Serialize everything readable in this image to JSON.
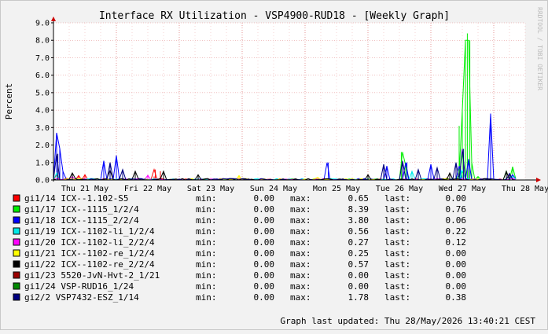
{
  "chart_data": {
    "type": "line",
    "title": "Interface RX Utilization - VSP4900-RUD18 - [Weekly Graph]",
    "ylabel": "Percent",
    "xlabel": "",
    "ylim": [
      0,
      9
    ],
    "yticks": [
      "0.0",
      "1.0",
      "2.0",
      "3.0",
      "4.0",
      "5.0",
      "6.0",
      "7.0",
      "8.0",
      "9.0"
    ],
    "xlim": [
      0,
      7.35
    ],
    "x_tick_labels": [
      {
        "x": 0.5,
        "label": "Thu 21 May"
      },
      {
        "x": 1.5,
        "label": "Fri 22 May"
      },
      {
        "x": 2.5,
        "label": "Sat 23 May"
      },
      {
        "x": 3.5,
        "label": "Sun 24 May"
      },
      {
        "x": 4.5,
        "label": "Mon 25 May"
      },
      {
        "x": 5.5,
        "label": "Tue 26 May"
      },
      {
        "x": 6.5,
        "label": "Wed 27 May"
      },
      {
        "x": 7.5,
        "label": "Thu 28 May"
      }
    ],
    "grid": true,
    "series": [
      {
        "name": "gi1/14 ICX--1.102-S5",
        "color": "#ff0000",
        "min": "0.00",
        "max": "0.65",
        "last": "0.00",
        "points": [
          [
            0.05,
            0.3
          ],
          [
            0.2,
            0.1
          ],
          [
            0.4,
            0.25
          ],
          [
            0.5,
            0.3
          ],
          [
            1.6,
            0.2
          ],
          [
            1.62,
            0.6
          ],
          [
            1.7,
            0.5
          ],
          [
            1.72,
            0.1
          ],
          [
            2.95,
            0.1
          ],
          [
            6.25,
            0.1
          ],
          [
            7.25,
            0.3
          ]
        ]
      },
      {
        "name": "gi1/17 ICX--1115_1/2/4",
        "color": "#00ee00",
        "min": "0.00",
        "max": "8.39",
        "last": "0.76",
        "points": [
          [
            5.53,
            1.6
          ],
          [
            5.6,
            0.8
          ],
          [
            6.45,
            3.1
          ],
          [
            6.46,
            0.3
          ],
          [
            6.5,
            4.0
          ],
          [
            6.55,
            8.0
          ],
          [
            6.58,
            8.39
          ],
          [
            6.62,
            8.0
          ],
          [
            6.65,
            1.0
          ],
          [
            6.75,
            0.2
          ],
          [
            7.2,
            0.5
          ],
          [
            7.3,
            0.76
          ]
        ]
      },
      {
        "name": "gi1/18 ICX--1115_2/2/4",
        "color": "#0000ff",
        "min": "0.00",
        "max": "3.80",
        "last": "0.06",
        "points": [
          [
            0.05,
            2.7
          ],
          [
            0.1,
            1.8
          ],
          [
            0.15,
            0.5
          ],
          [
            0.8,
            1.1
          ],
          [
            1.0,
            1.4
          ],
          [
            4.37,
            1.0
          ],
          [
            5.3,
            0.8
          ],
          [
            5.62,
            1.0
          ],
          [
            6.0,
            0.9
          ],
          [
            6.47,
            0.8
          ],
          [
            6.6,
            1.2
          ],
          [
            6.95,
            3.8
          ],
          [
            7.3,
            0.3
          ]
        ]
      },
      {
        "name": "gi1/19 ICX--1102-li_1/2/4",
        "color": "#00e8e8",
        "min": "0.00",
        "max": "0.56",
        "last": "0.22",
        "points": [
          [
            0.05,
            0.4
          ],
          [
            5.7,
            0.5
          ],
          [
            6.48,
            0.56
          ],
          [
            7.3,
            0.22
          ]
        ]
      },
      {
        "name": "gi1/20 ICX--1102-li_2/2/4",
        "color": "#ff00ff",
        "min": "0.00",
        "max": "0.27",
        "last": "0.12",
        "points": [
          [
            0.3,
            0.2
          ],
          [
            1.5,
            0.27
          ],
          [
            7.3,
            0.12
          ]
        ]
      },
      {
        "name": "gi1/21 ICX--1102-re_1/2/4",
        "color": "#ffff00",
        "min": "0.00",
        "max": "0.25",
        "last": "0.00",
        "points": [
          [
            2.95,
            0.25
          ],
          [
            4.2,
            0.15
          ]
        ]
      },
      {
        "name": "gi1/22 ICX--1102-re_2/2/4",
        "color": "#000000",
        "min": "0.00",
        "max": "0.57",
        "last": "0.00",
        "points": [
          [
            0.3,
            0.4
          ],
          [
            0.9,
            0.57
          ],
          [
            1.3,
            0.5
          ],
          [
            1.75,
            0.5
          ],
          [
            2.3,
            0.3
          ],
          [
            5.0,
            0.3
          ],
          [
            6.3,
            0.4
          ],
          [
            7.2,
            0.5
          ]
        ]
      },
      {
        "name": "gi1/23 5520-JvN-Hvt-2_1/21",
        "color": "#990000",
        "min": "0.00",
        "max": "0.00",
        "last": "0.00",
        "points": []
      },
      {
        "name": "gi1/24 VSP-RUD16_1/24",
        "color": "#008800",
        "min": "0.00",
        "max": "0.00",
        "last": "0.00",
        "points": []
      },
      {
        "name": "gi2/2 VSP7432-ESZ_1/14",
        "color": "#000080",
        "min": "0.00",
        "max": "1.78",
        "last": "0.38",
        "points": [
          [
            0.07,
            1.5
          ],
          [
            0.9,
            1.0
          ],
          [
            1.1,
            0.6
          ],
          [
            5.25,
            0.9
          ],
          [
            5.55,
            1.1
          ],
          [
            5.8,
            0.6
          ],
          [
            6.1,
            0.7
          ],
          [
            6.4,
            1.0
          ],
          [
            6.52,
            1.78
          ],
          [
            7.25,
            0.38
          ]
        ]
      }
    ],
    "legend_labels": {
      "min": "min:",
      "max": "max:",
      "last": "last:"
    },
    "footer": "Graph last updated: Thu 28/May/2026 13:40:21 CEST",
    "watermark": "RRDTOOL / TOBI OETIKER"
  }
}
